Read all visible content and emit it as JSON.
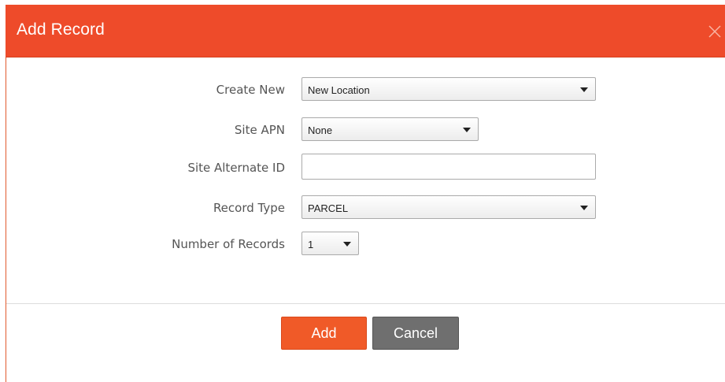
{
  "dialog": {
    "title": "Add Record",
    "close_icon": "close-icon"
  },
  "form": {
    "create_new": {
      "label": "Create New",
      "value": "New Location"
    },
    "site_apn": {
      "label": "Site APN",
      "value": "None"
    },
    "site_alternate_id": {
      "label": "Site Alternate ID",
      "value": ""
    },
    "record_type": {
      "label": "Record Type",
      "value": "PARCEL"
    },
    "number_of_records": {
      "label": "Number of Records",
      "value": "1"
    }
  },
  "footer": {
    "add_label": "Add",
    "cancel_label": "Cancel"
  },
  "colors": {
    "header": "#ee4b2a",
    "add_button": "#f05a28",
    "cancel_button": "#6f6f6f"
  }
}
